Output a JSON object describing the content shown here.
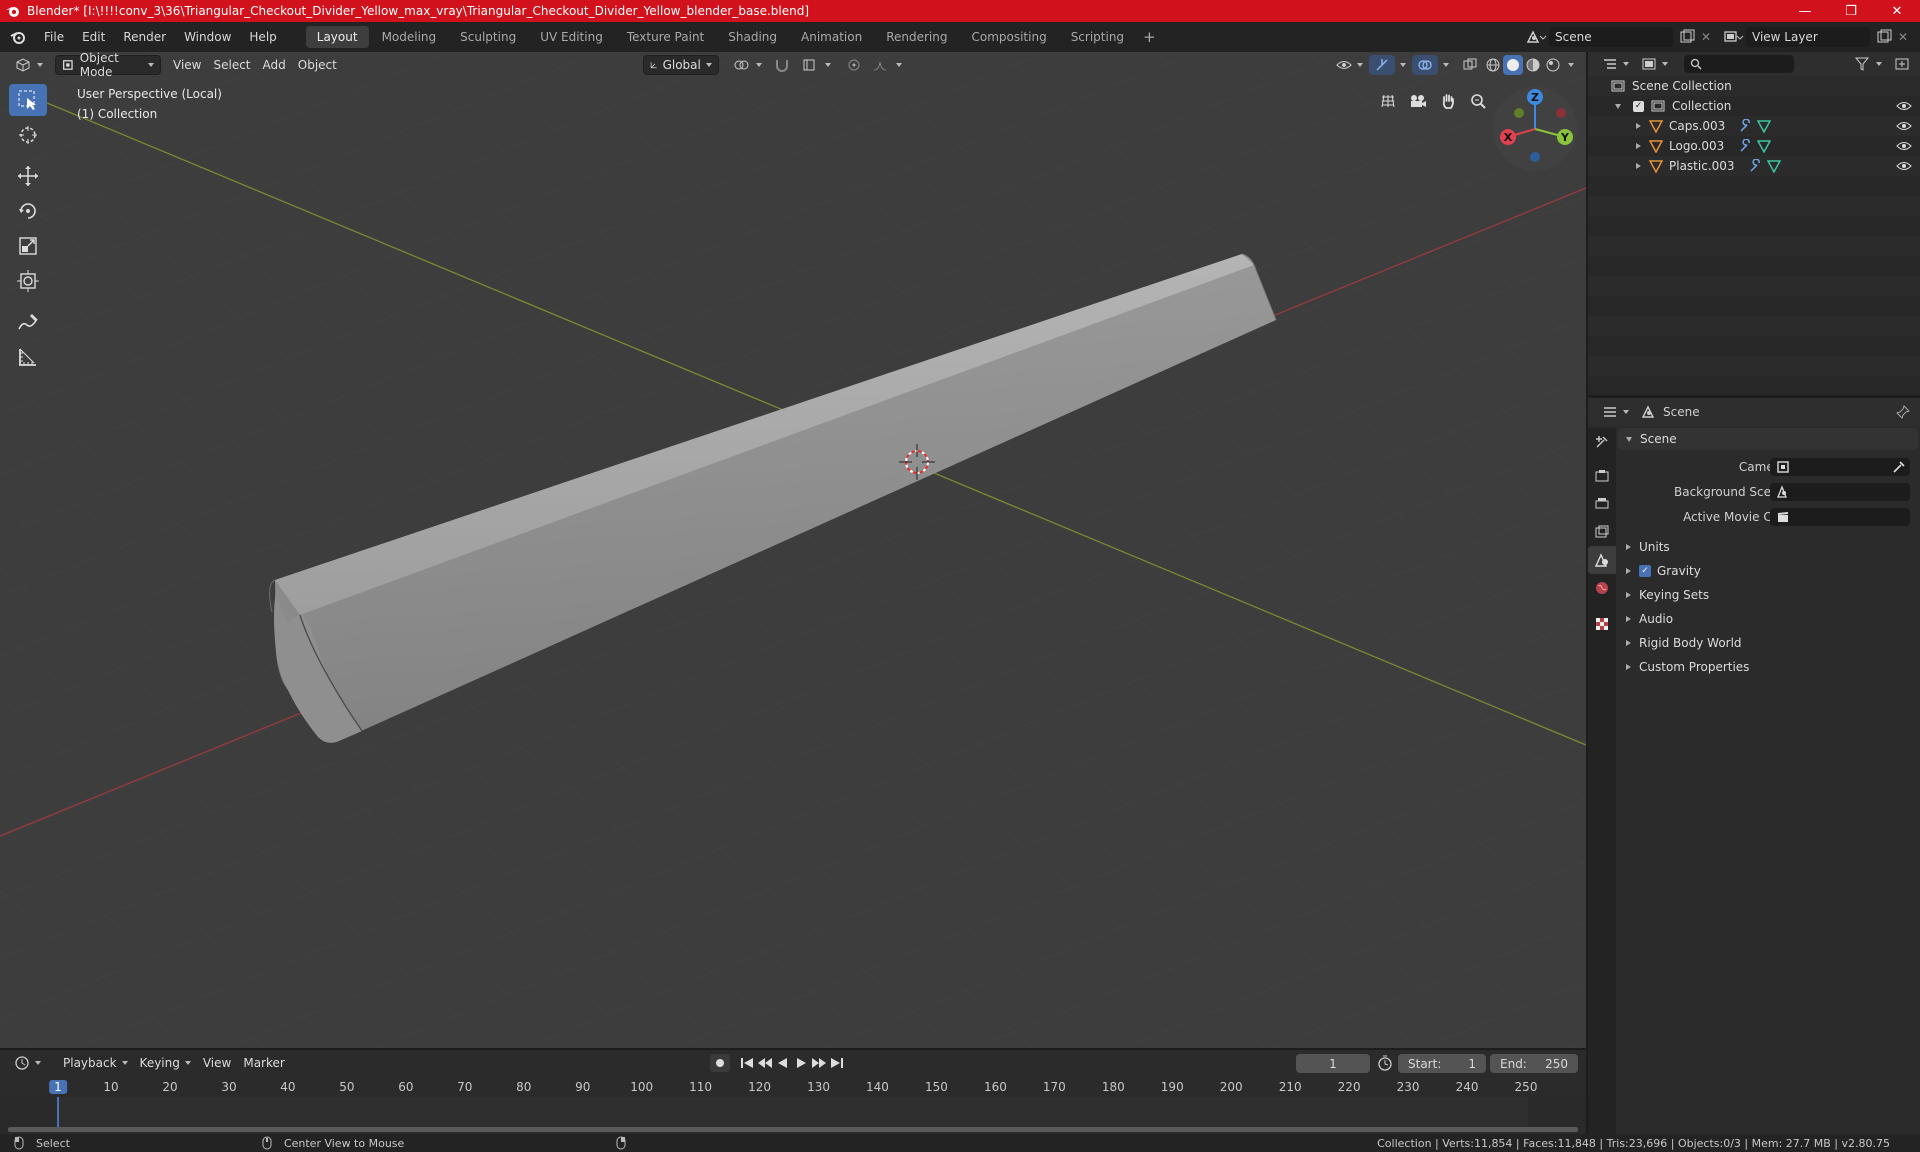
{
  "window": {
    "title": "Blender* [I:\\!!!!conv_3\\36\\Triangular_Checkout_Divider_Yellow_max_vray\\Triangular_Checkout_Divider_Yellow_blender_base.blend]",
    "minimize": "—",
    "maximize": "❐",
    "close": "✕"
  },
  "menu": {
    "items": [
      "File",
      "Edit",
      "Render",
      "Window",
      "Help"
    ]
  },
  "workspaces": {
    "tabs": [
      "Layout",
      "Modeling",
      "Sculpting",
      "UV Editing",
      "Texture Paint",
      "Shading",
      "Animation",
      "Rendering",
      "Compositing",
      "Scripting"
    ],
    "active": "Layout",
    "add": "+"
  },
  "scene_selector": {
    "value": "Scene"
  },
  "view_layer_selector": {
    "value": "View Layer"
  },
  "viewport": {
    "mode": "Object Mode",
    "menus": [
      "View",
      "Select",
      "Add",
      "Object"
    ],
    "transform_orientation": "Global",
    "info_line1": "User Perspective (Local)",
    "info_line2": "(1) Collection",
    "gizmo_axes": {
      "x": "X",
      "y": "Y",
      "z": "Z"
    }
  },
  "outliner": {
    "root": "Scene Collection",
    "collection": "Collection",
    "objects": [
      "Caps.003",
      "Logo.003",
      "Plastic.003"
    ]
  },
  "properties": {
    "context": "Scene",
    "panel_title": "Scene",
    "fields": [
      {
        "label": "Camera"
      },
      {
        "label": "Background Scene"
      },
      {
        "label": "Active Movie Clip"
      }
    ],
    "subpanels": [
      "Units",
      "Gravity",
      "Keying Sets",
      "Audio",
      "Rigid Body World",
      "Custom Properties"
    ]
  },
  "timeline": {
    "menus": [
      "Playback",
      "Keying",
      "View",
      "Marker"
    ],
    "current_frame": "1",
    "start_label": "Start:",
    "start": "1",
    "end_label": "End:",
    "end": "250",
    "ruler_ticks": [
      "1",
      "10",
      "20",
      "30",
      "40",
      "50",
      "60",
      "70",
      "80",
      "90",
      "100",
      "110",
      "120",
      "130",
      "140",
      "150",
      "160",
      "170",
      "180",
      "190",
      "200",
      "210",
      "220",
      "230",
      "240",
      "250"
    ]
  },
  "statusbar": {
    "select": "Select",
    "center_view": "Center View to Mouse",
    "stats": "Collection | Verts:11,854 | Faces:11,848 | Tris:23,696 | Objects:0/3 | Mem: 27.7 MB | v2.80.75"
  },
  "colors": {
    "title_bar": "#d1111c",
    "accent": "#4772b3",
    "axis_x": "#e0414f",
    "axis_y": "#8bc43b",
    "axis_z": "#3d8be0"
  }
}
